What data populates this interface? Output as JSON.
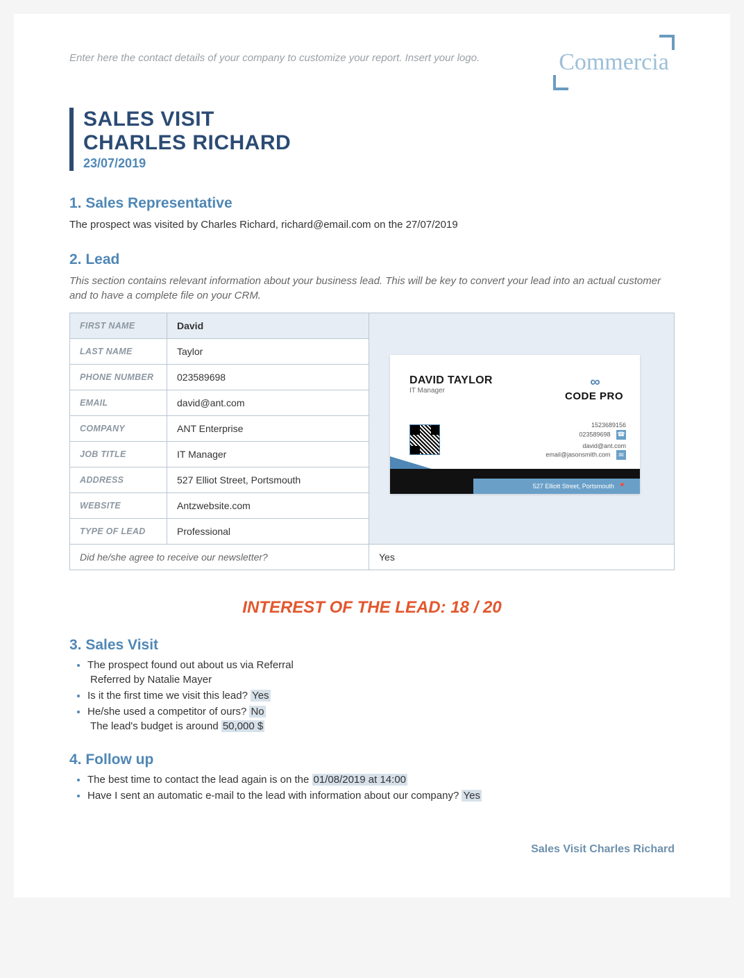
{
  "header": {
    "placeholder": "Enter here the contact details of your company to customize your report. Insert your logo.",
    "logo_text": "Commercia"
  },
  "title": {
    "line1": "SALES VISIT",
    "line2": "CHARLES RICHARD",
    "date": "23/07/2019"
  },
  "section1": {
    "heading": "1.   Sales Representative",
    "text": "The prospect was visited by Charles Richard, richard@email.com on the 27/07/2019"
  },
  "section2": {
    "heading": "2.   Lead",
    "intro": "This section contains relevant information about your business lead. This will be key to convert your lead into an actual customer and to have a complete file on your CRM.",
    "fields": {
      "first_name_label": "FIRST NAME",
      "first_name": "David",
      "last_name_label": "LAST NAME",
      "last_name": "Taylor",
      "phone_label": "PHONE NUMBER",
      "phone": "023589698",
      "email_label": "EMAIL",
      "email": "david@ant.com",
      "company_label": "COMPANY",
      "company": "ANT Enterprise",
      "job_label": "JOB TITLE",
      "job": "IT Manager",
      "address_label": "ADDRESS",
      "address": "527 Elliot Street, Portsmouth",
      "website_label": "WEBSITE",
      "website": "Antzwebsite.com",
      "type_label": "TYPE OF LEAD",
      "type": "Professional"
    },
    "newsletter_q": "Did he/she agree to receive our newsletter?",
    "newsletter_a": "Yes"
  },
  "card": {
    "name": "DAVID TAYLOR",
    "title": "IT Manager",
    "brand": "CODE PRO",
    "phone1": "1523689156",
    "phone2": "023589698",
    "email1": "david@ant.com",
    "email2": "email@jasonsmith.com",
    "address": "527  Elliott Street, Portsmouth"
  },
  "interest": "INTEREST OF THE LEAD: 18 / 20",
  "section3": {
    "heading": "3.   Sales Visit",
    "b1": "The prospect found out about us via Referral",
    "b1_sub": "Referred by Natalie Mayer",
    "b2_pre": "Is it the first time we visit this lead? ",
    "b2_hl": "Yes",
    "b3_pre": "He/she used a competitor of ours? ",
    "b3_hl": "No",
    "b3_sub_pre": "The lead's budget is around ",
    "b3_sub_hl": "50,000 $"
  },
  "section4": {
    "heading": "4.   Follow up",
    "b1_pre": "The best time to contact the lead again is on the ",
    "b1_hl": "01/08/2019 at 14:00",
    "b2_pre": "Have I sent an automatic e-mail to the lead with information about our company? ",
    "b2_hl": "Yes"
  },
  "footer": "Sales Visit Charles Richard"
}
